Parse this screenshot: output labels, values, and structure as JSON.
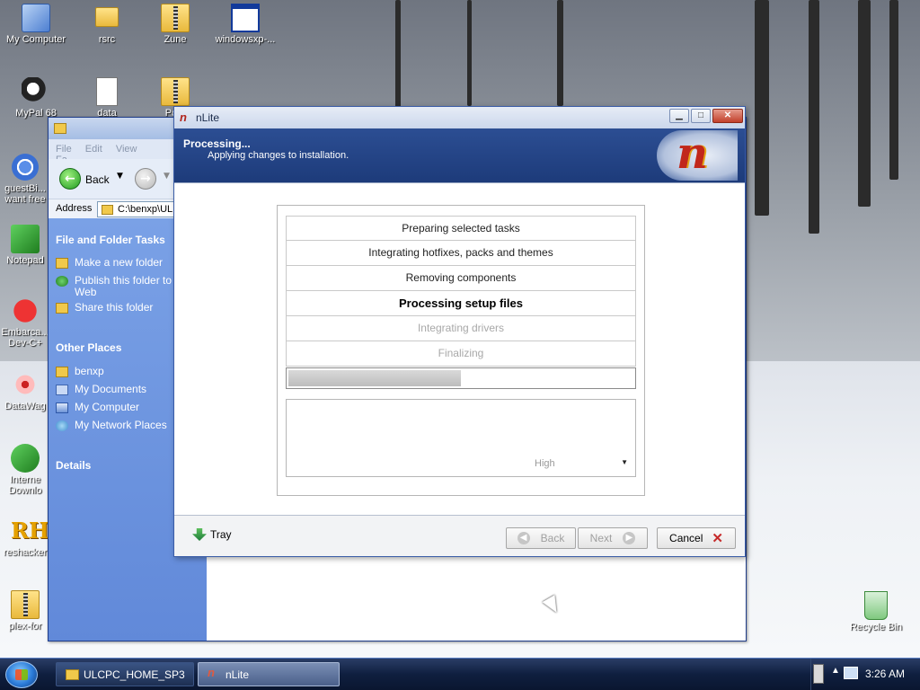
{
  "desktop": {
    "icons": [
      {
        "label": "My Computer"
      },
      {
        "label": "rsrc"
      },
      {
        "label": "Zune"
      },
      {
        "label": "windowsxp-..."
      },
      {
        "label": "MyPal 68"
      },
      {
        "label": "data"
      },
      {
        "label": "Po..."
      },
      {
        "label": "guestBi... want free"
      },
      {
        "label": "Notepad"
      },
      {
        "label": "Embarca... Dev-C+"
      },
      {
        "label": "DataWag"
      },
      {
        "label": "Interne Downlo"
      },
      {
        "label": "reshacker"
      },
      {
        "label": "plex-for"
      },
      {
        "label": "Recycle Bin"
      }
    ]
  },
  "explorer": {
    "menu": [
      "File",
      "Edit",
      "View",
      "Fa"
    ],
    "back_label": "Back",
    "address_label": "Address",
    "address_value": "C:\\benxp\\UL",
    "file_tasks_title": "File and Folder Tasks",
    "file_tasks": [
      "Make a new folder",
      "Publish this folder to Web",
      "Share this folder"
    ],
    "other_places_title": "Other Places",
    "other_places": [
      "benxp",
      "My Documents",
      "My Computer",
      "My Network Places"
    ],
    "details_title": "Details"
  },
  "nlite": {
    "title": "nLite",
    "header_title": "Processing...",
    "header_subtitle": "Applying changes to installation.",
    "steps": [
      {
        "label": "Preparing selected tasks",
        "state": "done"
      },
      {
        "label": "Integrating hotfixes, packs and themes",
        "state": "done"
      },
      {
        "label": "Removing components",
        "state": "done"
      },
      {
        "label": "Processing setup files",
        "state": "current"
      },
      {
        "label": "Integrating drivers",
        "state": "pending"
      },
      {
        "label": "Finalizing",
        "state": "pending"
      }
    ],
    "progress_fraction": 0.5,
    "priority": "High",
    "tray_label": "Tray",
    "back_label": "Back",
    "next_label": "Next",
    "cancel_label": "Cancel"
  },
  "taskbar": {
    "tasks": [
      {
        "label": "ULCPC_HOME_SP3",
        "active": false
      },
      {
        "label": "nLite",
        "active": true
      }
    ],
    "clock": "3:26 AM"
  }
}
